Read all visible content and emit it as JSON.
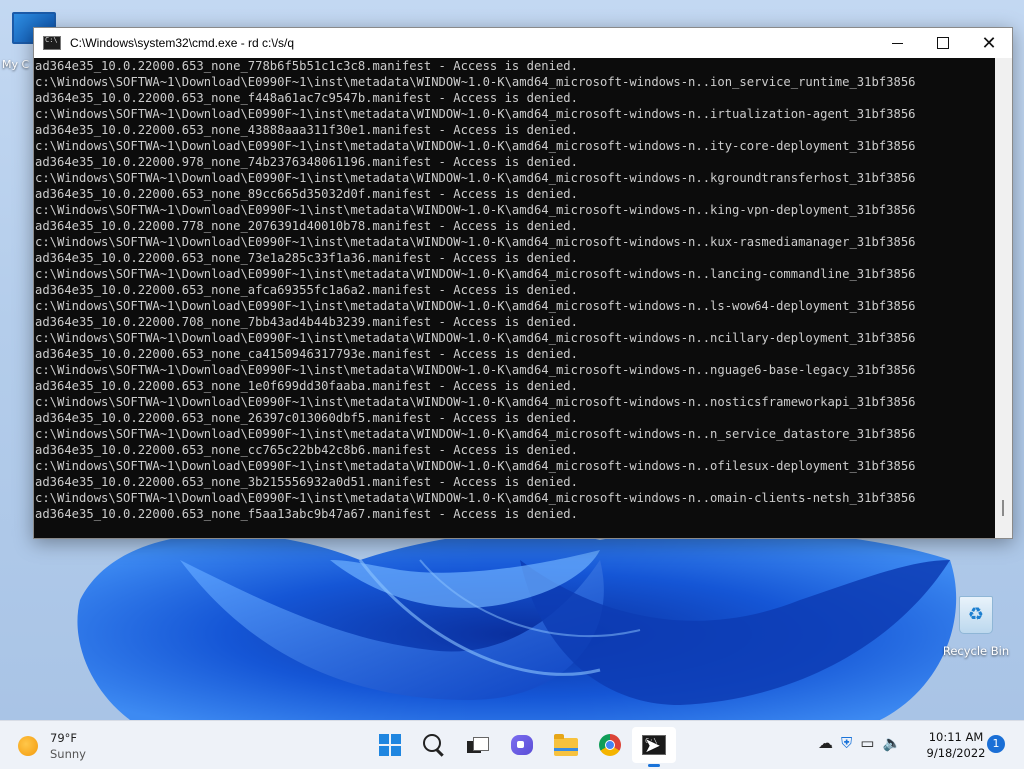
{
  "desktop": {
    "mypc_label": "My C",
    "recycle_bin_label": "Recycle Bin"
  },
  "window": {
    "title": "C:\\Windows\\system32\\cmd.exe - rd  c:\\/s/q",
    "controls": {
      "minimize": "minimize",
      "maximize": "maximize",
      "close": "✕"
    }
  },
  "console": {
    "lines": [
      "ad364e35_10.0.22000.653_none_778b6f5b51c1c3c8.manifest - Access is denied.",
      "c:\\Windows\\SOFTWA~1\\Download\\E0990F~1\\inst\\metadata\\WINDOW~1.0-K\\amd64_microsoft-windows-n..ion_service_runtime_31bf3856",
      "ad364e35_10.0.22000.653_none_f448a61ac7c9547b.manifest - Access is denied.",
      "c:\\Windows\\SOFTWA~1\\Download\\E0990F~1\\inst\\metadata\\WINDOW~1.0-K\\amd64_microsoft-windows-n..irtualization-agent_31bf3856",
      "ad364e35_10.0.22000.653_none_43888aaa311f30e1.manifest - Access is denied.",
      "c:\\Windows\\SOFTWA~1\\Download\\E0990F~1\\inst\\metadata\\WINDOW~1.0-K\\amd64_microsoft-windows-n..ity-core-deployment_31bf3856",
      "ad364e35_10.0.22000.978_none_74b2376348061196.manifest - Access is denied.",
      "c:\\Windows\\SOFTWA~1\\Download\\E0990F~1\\inst\\metadata\\WINDOW~1.0-K\\amd64_microsoft-windows-n..kgroundtransferhost_31bf3856",
      "ad364e35_10.0.22000.653_none_89cc665d35032d0f.manifest - Access is denied.",
      "c:\\Windows\\SOFTWA~1\\Download\\E0990F~1\\inst\\metadata\\WINDOW~1.0-K\\amd64_microsoft-windows-n..king-vpn-deployment_31bf3856",
      "ad364e35_10.0.22000.778_none_2076391d40010b78.manifest - Access is denied.",
      "c:\\Windows\\SOFTWA~1\\Download\\E0990F~1\\inst\\metadata\\WINDOW~1.0-K\\amd64_microsoft-windows-n..kux-rasmediamanager_31bf3856",
      "ad364e35_10.0.22000.653_none_73e1a285c33f1a36.manifest - Access is denied.",
      "c:\\Windows\\SOFTWA~1\\Download\\E0990F~1\\inst\\metadata\\WINDOW~1.0-K\\amd64_microsoft-windows-n..lancing-commandline_31bf3856",
      "ad364e35_10.0.22000.653_none_afca69355fc1a6a2.manifest - Access is denied.",
      "c:\\Windows\\SOFTWA~1\\Download\\E0990F~1\\inst\\metadata\\WINDOW~1.0-K\\amd64_microsoft-windows-n..ls-wow64-deployment_31bf3856",
      "ad364e35_10.0.22000.708_none_7bb43ad4b44b3239.manifest - Access is denied.",
      "c:\\Windows\\SOFTWA~1\\Download\\E0990F~1\\inst\\metadata\\WINDOW~1.0-K\\amd64_microsoft-windows-n..ncillary-deployment_31bf3856",
      "ad364e35_10.0.22000.653_none_ca4150946317793e.manifest - Access is denied.",
      "c:\\Windows\\SOFTWA~1\\Download\\E0990F~1\\inst\\metadata\\WINDOW~1.0-K\\amd64_microsoft-windows-n..nguage6-base-legacy_31bf3856",
      "ad364e35_10.0.22000.653_none_1e0f699dd30faaba.manifest - Access is denied.",
      "c:\\Windows\\SOFTWA~1\\Download\\E0990F~1\\inst\\metadata\\WINDOW~1.0-K\\amd64_microsoft-windows-n..nosticsframeworkapi_31bf3856",
      "ad364e35_10.0.22000.653_none_26397c013060dbf5.manifest - Access is denied.",
      "c:\\Windows\\SOFTWA~1\\Download\\E0990F~1\\inst\\metadata\\WINDOW~1.0-K\\amd64_microsoft-windows-n..n_service_datastore_31bf3856",
      "ad364e35_10.0.22000.653_none_cc765c22bb42c8b6.manifest - Access is denied.",
      "c:\\Windows\\SOFTWA~1\\Download\\E0990F~1\\inst\\metadata\\WINDOW~1.0-K\\amd64_microsoft-windows-n..ofilesux-deployment_31bf3856",
      "ad364e35_10.0.22000.653_none_3b215556932a0d51.manifest - Access is denied.",
      "c:\\Windows\\SOFTWA~1\\Download\\E0990F~1\\inst\\metadata\\WINDOW~1.0-K\\amd64_microsoft-windows-n..omain-clients-netsh_31bf3856",
      "ad364e35_10.0.22000.653_none_f5aa13abc9b47a67.manifest - Access is denied."
    ]
  },
  "taskbar": {
    "weather_temp": "79°F",
    "weather_condition": "Sunny",
    "apps": [
      "start-icon",
      "search-icon",
      "task-view-icon",
      "chat-icon",
      "file-explorer-icon",
      "chrome-icon",
      "cmd-icon"
    ],
    "clock_time": "10:11 AM",
    "clock_date": "9/18/2022",
    "notification_count": "1",
    "accent_color": "#1a73d9"
  }
}
